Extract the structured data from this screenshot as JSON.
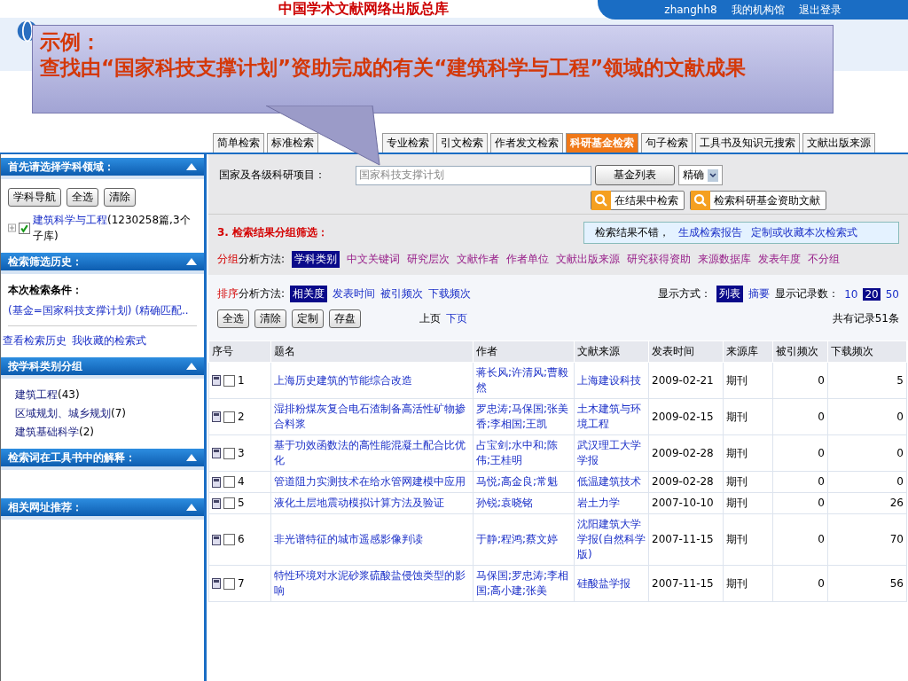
{
  "header": {
    "title": "中国学术文献网络出版总库",
    "user": "zhanghh8",
    "links": [
      "我的机构馆",
      "退出登录"
    ]
  },
  "callout": {
    "label": "示例：",
    "text": "查找由“国家科技支撑计划”资助完成的有关“建筑科学与工程”领域的文献成果"
  },
  "tabs": [
    {
      "label": "简单检索",
      "selected": false
    },
    {
      "label": "标准检索",
      "selected": false
    },
    {
      "label": "专业检索",
      "selected": false
    },
    {
      "label": "引文检索",
      "selected": false
    },
    {
      "label": "作者发文检索",
      "selected": false
    },
    {
      "label": "科研基金检索",
      "selected": true
    },
    {
      "label": "句子检索",
      "selected": false
    },
    {
      "label": "工具书及知识元搜索",
      "selected": false
    },
    {
      "label": "文献出版来源",
      "selected": false
    }
  ],
  "sidebar": [
    {
      "kind": "subject",
      "title": "首先请选择学科领域：",
      "buttons": [
        "学科导航",
        "全选",
        "清除"
      ],
      "tree": [
        {
          "label": "建筑科学与工程",
          "count": "(1230258篇,3个子库)",
          "checked": true,
          "expanded": false
        }
      ]
    },
    {
      "kind": "history",
      "title": "检索筛选历史：",
      "conditions_label": "本次检索条件：",
      "condition": "(基金=国家科技支撑计划) (精确匹配..",
      "links": [
        "查看检索历史",
        "我收藏的检索式"
      ]
    },
    {
      "kind": "groups",
      "title": "按学科类别分组",
      "items": [
        {
          "name": "建筑工程",
          "count": "(43)"
        },
        {
          "name": "区域规划、城乡规划",
          "count": "(7)"
        },
        {
          "name": "建筑基础科学",
          "count": "(2)"
        }
      ]
    },
    {
      "kind": "empty",
      "title": "检索词在工具书中的解释："
    },
    {
      "kind": "empty",
      "title": "相关网址推荐："
    }
  ],
  "fund_search": {
    "label": "国家及各级科研项目：",
    "value": "国家科技支撑计划",
    "list_button": "基金列表",
    "match": "精确",
    "buttons": [
      "在结果中检索",
      "检索科研基金资助文献"
    ]
  },
  "grouping": {
    "title": "3. 检索结果分组筛选：",
    "notice": "检索结果不错，",
    "notice_links": [
      "生成检索报告",
      "定制或收藏本次检索式"
    ],
    "prefix": "分组",
    "label": "分析方法:",
    "options": [
      {
        "label": "学科类别",
        "selected": true
      },
      {
        "label": "中文关键词",
        "selected": false
      },
      {
        "label": "研究层次",
        "selected": false
      },
      {
        "label": "文献作者",
        "selected": false
      },
      {
        "label": "作者单位",
        "selected": false
      },
      {
        "label": "文献出版来源",
        "selected": false
      },
      {
        "label": "研究获得资助",
        "selected": false
      },
      {
        "label": "来源数据库",
        "selected": false
      },
      {
        "label": "发表年度",
        "selected": false
      },
      {
        "label": "不分组",
        "selected": false
      }
    ]
  },
  "sorting": {
    "prefix": "排序",
    "label": "分析方法:",
    "options": [
      {
        "label": "相关度",
        "selected": true
      },
      {
        "label": "发表时间",
        "selected": false
      },
      {
        "label": "被引频次",
        "selected": false
      },
      {
        "label": "下载频次",
        "selected": false
      }
    ],
    "display_label": "显示方式：",
    "display": [
      {
        "label": "列表",
        "selected": true
      },
      {
        "label": "摘要",
        "selected": false
      }
    ],
    "count_label": "显示记录数：",
    "counts": [
      {
        "label": "10",
        "selected": false
      },
      {
        "label": "20",
        "selected": true
      },
      {
        "label": "50",
        "selected": false
      }
    ],
    "buttons": [
      "全选",
      "清除",
      "定制",
      "存盘"
    ],
    "pager": [
      "上页",
      "下页"
    ],
    "total": "共有记录51条"
  },
  "table": {
    "columns": [
      "序号",
      "题名",
      "作者",
      "文献来源",
      "发表时间",
      "来源库",
      "被引频次",
      "下载频次"
    ],
    "rows": [
      {
        "no": "1",
        "checked": false,
        "title": "上海历史建筑的节能综合改造",
        "authors": "蒋长风;许清风;曹毅然",
        "source": "上海建设科技",
        "date": "2009-02-21",
        "db": "期刊",
        "cited": "0",
        "downloads": "5"
      },
      {
        "no": "2",
        "checked": false,
        "title": "湿排粉煤灰复合电石渣制备高活性矿物掺合料浆",
        "authors": "罗忠涛;马保国;张美香;李相国;王凯",
        "source": "土木建筑与环境工程",
        "date": "2009-02-15",
        "db": "期刊",
        "cited": "0",
        "downloads": "0"
      },
      {
        "no": "3",
        "checked": false,
        "title": "基于功效函数法的高性能混凝土配合比优化",
        "authors": "占宝剑;水中和;陈伟;王桂明",
        "source": "武汉理工大学学报",
        "date": "2009-02-28",
        "db": "期刊",
        "cited": "0",
        "downloads": "0"
      },
      {
        "no": "4",
        "checked": false,
        "title": "管道阻力实测技术在给水管网建模中应用",
        "authors": "马悦;高金良;常魁",
        "source": "低温建筑技术",
        "date": "2009-02-28",
        "db": "期刊",
        "cited": "0",
        "downloads": "0"
      },
      {
        "no": "5",
        "checked": false,
        "title": "液化土层地震动模拟计算方法及验证",
        "authors": "孙锐;袁晓铭",
        "source": "岩土力学",
        "date": "2007-10-10",
        "db": "期刊",
        "cited": "0",
        "downloads": "26"
      },
      {
        "no": "6",
        "checked": false,
        "title": "非光谱特征的城市遥感影像判读",
        "authors": "于静;程鸿;蔡文婷",
        "source": "沈阳建筑大学学报(自然科学版)",
        "date": "2007-11-15",
        "db": "期刊",
        "cited": "0",
        "downloads": "70"
      },
      {
        "no": "7",
        "checked": false,
        "title": "特性环境对水泥砂浆硫酸盐侵蚀类型的影响",
        "authors": "马保国;罗忠涛;李相国;高小建;张美",
        "source": "硅酸盐学报",
        "date": "2007-11-15",
        "db": "期刊",
        "cited": "0",
        "downloads": "56"
      }
    ]
  }
}
